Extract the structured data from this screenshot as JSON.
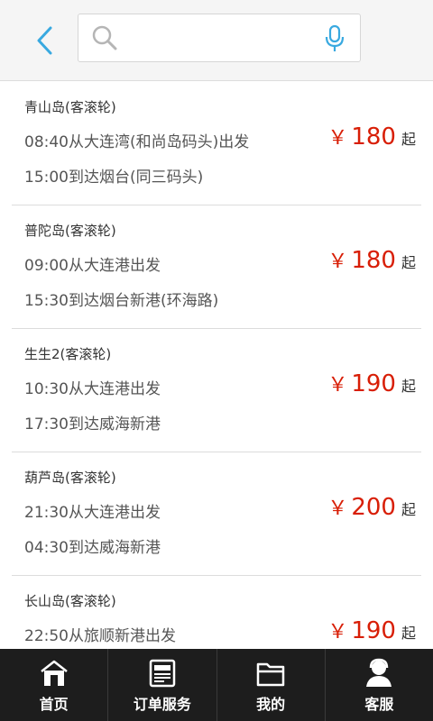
{
  "header": {
    "back_icon": "chevron-left-icon",
    "search": {
      "placeholder": "",
      "value": "",
      "icon": "search-icon",
      "voice_icon": "microphone-icon"
    }
  },
  "colors": {
    "accent": "#39a9e0",
    "price": "#d81e06",
    "tabbar": "#1d1d1d"
  },
  "routes": [
    {
      "name": "青山岛(客滚轮)",
      "depart": "08:40从大连湾(和尚岛码头)出发",
      "arrive": "15:00到达烟台(同三码头)",
      "price_symbol": "￥",
      "price": "180",
      "price_suffix": "起"
    },
    {
      "name": "普陀岛(客滚轮)",
      "depart": "09:00从大连港出发",
      "arrive": "15:30到达烟台新港(环海路)",
      "price_symbol": "￥",
      "price": "180",
      "price_suffix": "起"
    },
    {
      "name": "生生2(客滚轮)",
      "depart": "10:30从大连港出发",
      "arrive": "17:30到达威海新港",
      "price_symbol": "￥",
      "price": "190",
      "price_suffix": "起"
    },
    {
      "name": "葫芦岛(客滚轮)",
      "depart": "21:30从大连港出发",
      "arrive": "04:30到达威海新港",
      "price_symbol": "￥",
      "price": "200",
      "price_suffix": "起"
    },
    {
      "name": "长山岛(客滚轮)",
      "depart": "22:50从旅顺新港出发",
      "arrive": "",
      "price_symbol": "￥",
      "price": "190",
      "price_suffix": "起"
    }
  ],
  "tabbar": {
    "tabs": [
      {
        "label": "首页",
        "icon": "home-icon"
      },
      {
        "label": "订单服务",
        "icon": "newspaper-icon"
      },
      {
        "label": "我的",
        "icon": "folder-icon"
      },
      {
        "label": "客服",
        "icon": "customer-service-icon"
      }
    ]
  }
}
